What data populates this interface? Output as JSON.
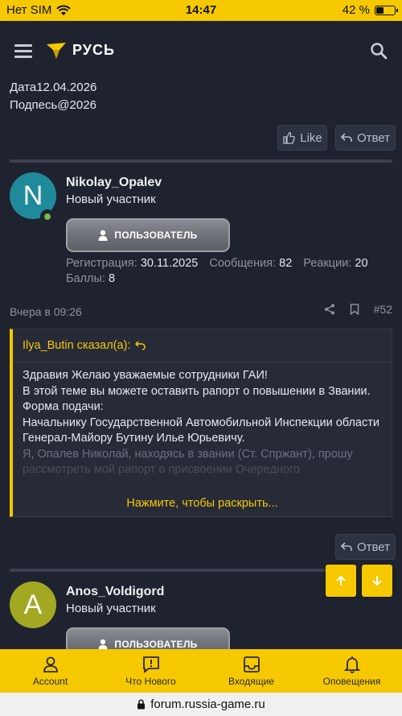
{
  "status": {
    "carrier": "Нет SIM",
    "time": "14:47",
    "battery": "42 %",
    "battery_level": 0.42
  },
  "header": {
    "logo_text": "РУСЬ"
  },
  "prev_post": {
    "sig_line1": "Дата12.04.2026",
    "sig_line2": "Подпесь@2026",
    "like_label": "Like",
    "reply_label": "Ответ"
  },
  "post": {
    "avatar_letter": "N",
    "username": "Nikolay_Opalev",
    "title": "Новый участник",
    "role": "ПОЛЬЗОВАТЕЛЬ",
    "reg_label": "Регистрация:",
    "reg_value": "30.11.2025",
    "msg_label": "Сообщения:",
    "msg_value": "82",
    "react_label": "Реакции:",
    "react_value": "20",
    "points_label": "Баллы:",
    "points_value": "8",
    "date": "Вчера в 09:26",
    "number": "#52",
    "reply_label": "Ответ",
    "quote": {
      "author": "Ilya_Butin сказал(а):",
      "lines": [
        "Здравия Желаю уважаемые сотрудники ГАИ!",
        "В этой теме вы можете оставить рапорт о повышении в Звании.",
        "Форма подачи:",
        "Начальнику Государственной Автомобильной Инспекции области Генерал-Майору Бутину Илье Юрьевичу."
      ],
      "faded_line": "Я, Опалев Николай, находясь в звании (Ст. Спржант), прошу",
      "faded_line2": "рассмотреть мой рапорт о присвоении Очередного",
      "expand": "Нажмите, чтобы раскрыть..."
    }
  },
  "next_post": {
    "avatar_letter": "A",
    "username": "Anos_Voldigord",
    "title": "Новый участник",
    "role": "ПОЛЬЗОВАТЕЛЬ"
  },
  "tabs": [
    {
      "label": "Account",
      "icon": "account-icon"
    },
    {
      "label": "Что Нового",
      "icon": "whats-new-icon"
    },
    {
      "label": "Входящие",
      "icon": "inbox-icon"
    },
    {
      "label": "Оповещения",
      "icon": "bell-icon"
    }
  ],
  "url": "forum.russia-game.ru",
  "colors": {
    "accent": "#f5c800",
    "background": "#1f2330",
    "avatar_n": "#1f8a9a",
    "avatar_a": "#a3a822"
  }
}
